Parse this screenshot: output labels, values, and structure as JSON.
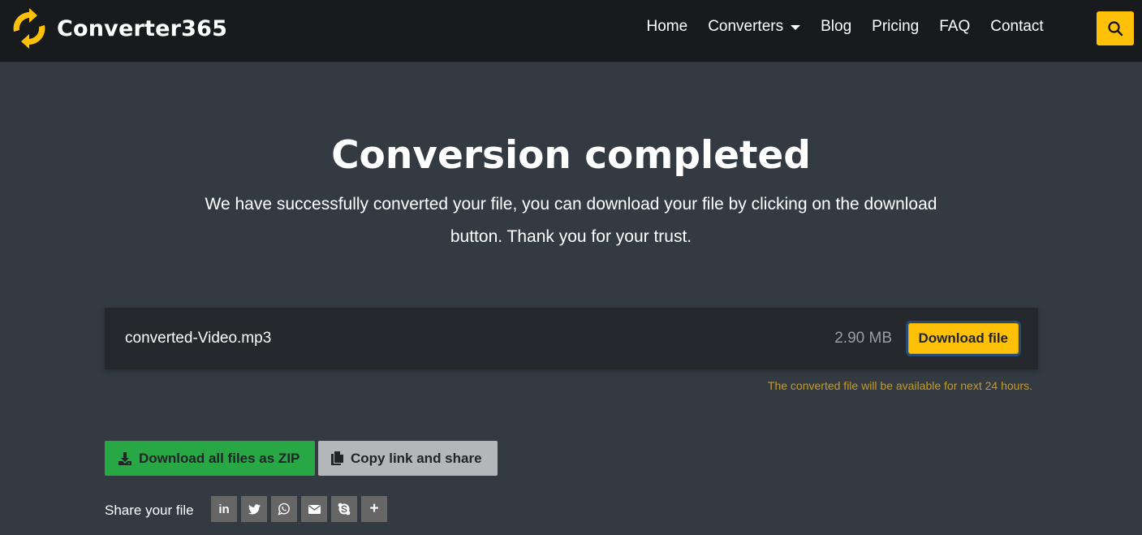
{
  "header": {
    "brand_name": "Converter365",
    "nav": [
      {
        "label": "Home"
      },
      {
        "label": "Converters",
        "has_dropdown": true
      },
      {
        "label": "Blog"
      },
      {
        "label": "Pricing"
      },
      {
        "label": "FAQ"
      },
      {
        "label": "Contact"
      }
    ],
    "search_icon": "search-icon"
  },
  "hero": {
    "title": "Conversion completed",
    "text": "We have successfully converted your file, you can download your file by clicking on the download button. Thank you for your trust."
  },
  "file": {
    "name": "converted-Video.mp3",
    "size": "2.90 MB",
    "download_label": "Download file",
    "availability_note": "The converted file will be available for next 24 hours."
  },
  "actions": {
    "zip_label": "Download all files as ZIP",
    "zip_icon": "download-icon",
    "copy_label": "Copy link and share",
    "copy_icon": "copy-icon"
  },
  "share": {
    "label": "Share your file",
    "services": [
      {
        "name": "linkedin",
        "glyph": "in"
      },
      {
        "name": "twitter",
        "glyph": ""
      },
      {
        "name": "whatsapp",
        "glyph": ""
      },
      {
        "name": "email",
        "glyph": ""
      },
      {
        "name": "skype",
        "glyph": ""
      },
      {
        "name": "more",
        "glyph": "+"
      }
    ]
  },
  "colors": {
    "accent": "#ffc107",
    "header_bg": "#181b1e",
    "page_bg": "#343a42",
    "card_bg": "#25282d",
    "zip_button": "#28a745",
    "copy_button": "#b5b6b9",
    "note_text": "#c89a24",
    "share_button": "#666666"
  }
}
